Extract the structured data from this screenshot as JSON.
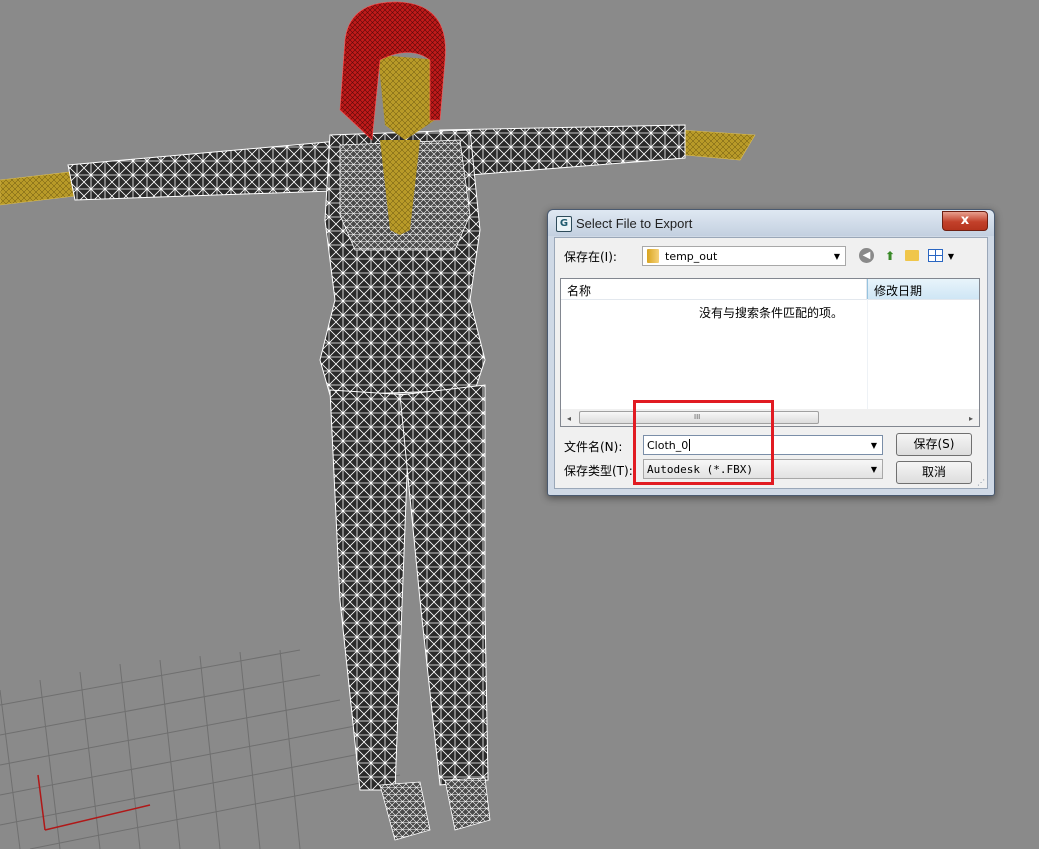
{
  "dialog": {
    "title": "Select File to Export",
    "app_icon": "G",
    "close_symbol": "x",
    "save_in_label": "保存在(I):",
    "folder_name": "temp_out",
    "combo_arrow": "▼",
    "toolbar_icons": [
      "back-icon",
      "up-folder-icon",
      "new-folder-icon",
      "views-menu-icon"
    ],
    "columns": {
      "name": "名称",
      "date_modified": "修改日期",
      "sort_indicator": "^"
    },
    "empty_message": "没有与搜索条件匹配的项。",
    "scroll": {
      "left_arrow": "◂",
      "right_arrow": "▸",
      "grip": "III"
    },
    "file_name_label": "文件名(N):",
    "file_name_value": "Cloth_0",
    "file_type_label": "保存类型(T):",
    "file_type_value": "Autodesk (*.FBX)",
    "save_button": "保存(S)",
    "cancel_button": "取消",
    "resize_grip": "⋰"
  },
  "annotation": {
    "color": "#e11b22"
  },
  "colors": {
    "viewport_bg": "#8a8a8a",
    "hair": "#b0151a",
    "skin": "#b69a2a",
    "suit": "#222222",
    "wire": "#ffffff",
    "axis": "#b01818"
  }
}
